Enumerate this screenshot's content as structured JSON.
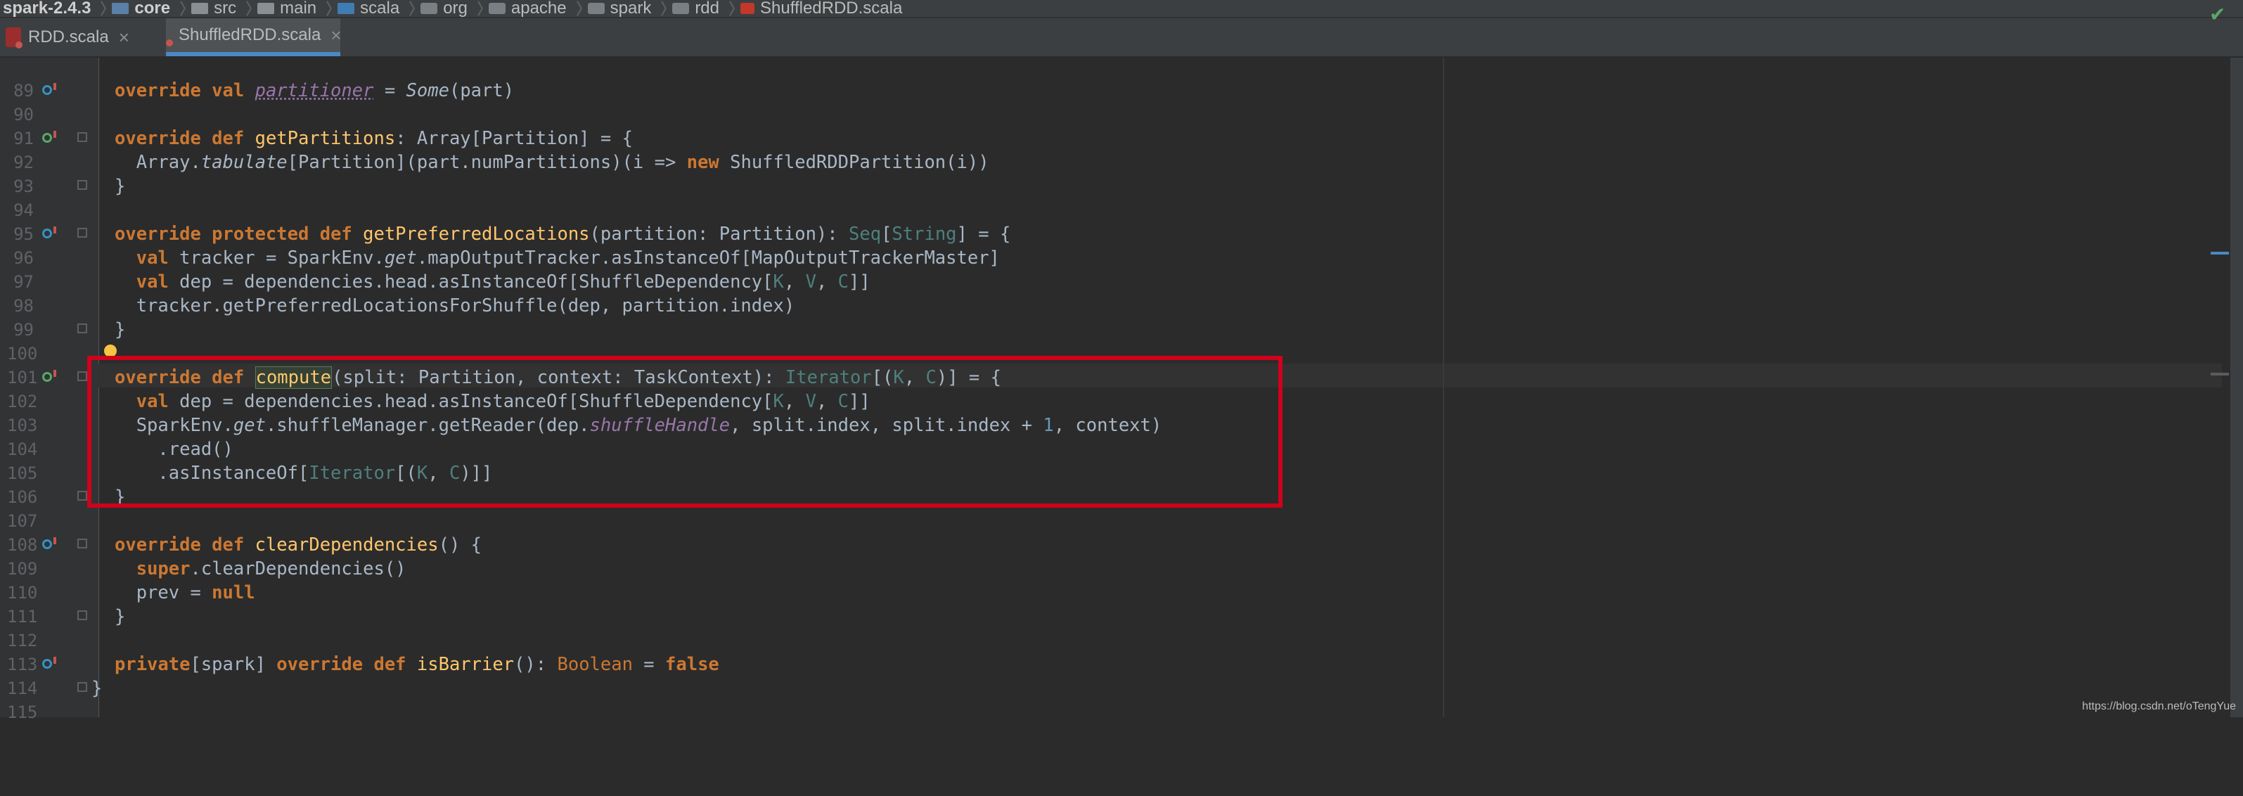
{
  "breadcrumb": [
    {
      "label": "spark-2.4.3",
      "icon": "none",
      "bold": true
    },
    {
      "label": "core",
      "icon": "module-folder-icon",
      "bold": true
    },
    {
      "label": "src",
      "icon": "folder-icon",
      "bold": false
    },
    {
      "label": "main",
      "icon": "folder-icon",
      "bold": false
    },
    {
      "label": "scala",
      "icon": "source-folder-icon",
      "bold": false
    },
    {
      "label": "org",
      "icon": "package-icon",
      "bold": false
    },
    {
      "label": "apache",
      "icon": "package-icon",
      "bold": false
    },
    {
      "label": "spark",
      "icon": "package-icon",
      "bold": false
    },
    {
      "label": "rdd",
      "icon": "package-icon",
      "bold": false
    },
    {
      "label": "ShuffledRDD.scala",
      "icon": "scala-file-icon",
      "bold": false
    }
  ],
  "tabs": [
    {
      "label": "RDD.scala",
      "close": "×",
      "active": false
    },
    {
      "label": "ShuffledRDD.scala",
      "close": "×",
      "active": true
    }
  ],
  "editor": {
    "line_numbers": [
      "89",
      "90",
      "91",
      "92",
      "93",
      "94",
      "95",
      "96",
      "97",
      "98",
      "99",
      "100",
      "101",
      "102",
      "103",
      "104",
      "105",
      "106",
      "107",
      "108",
      "109",
      "110",
      "111",
      "112",
      "113",
      "114",
      "115"
    ],
    "highlighted_method": "compute",
    "annotated_range": [
      "102",
      "107"
    ]
  },
  "colors": {
    "keyword": "#cc7832",
    "function": "#ffc66d",
    "number": "#6897bb",
    "type_param": "#4e807d",
    "field": "#9876aa",
    "annotation_box": "#d0021b",
    "background": "#2b2b2b"
  },
  "watermark": "https://blog.csdn.net/oTengYue"
}
